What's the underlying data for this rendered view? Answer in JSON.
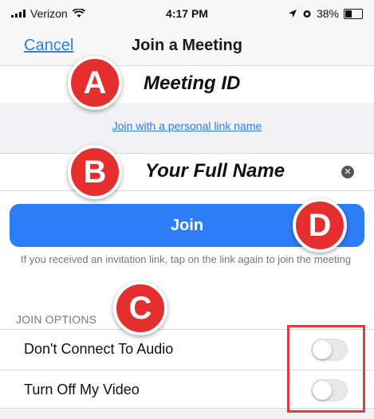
{
  "status_bar": {
    "carrier": "Verizon",
    "time": "4:17 PM",
    "battery": "38%"
  },
  "nav": {
    "cancel_label": "Cancel",
    "title": "Join a Meeting"
  },
  "meeting_id_field": {
    "text": "Meeting ID"
  },
  "personal_link": {
    "label": "Join with a personal link name"
  },
  "name_field": {
    "text": "Your Full Name",
    "clear_icon": "x-circle-icon"
  },
  "join_button": {
    "label": "Join"
  },
  "info_text": "If you received an invitation link, tap on the link again to join the meeting",
  "join_options": {
    "header": "JOIN OPTIONS",
    "items": [
      {
        "label": "Don't Connect To Audio",
        "enabled": false
      },
      {
        "label": "Turn Off My Video",
        "enabled": false
      }
    ]
  },
  "annotations": {
    "badges": [
      "A",
      "B",
      "C",
      "D"
    ],
    "badge_color": "#e52f2f",
    "highlight_color": "#e23c3c"
  },
  "colors": {
    "accent": "#2d7df6",
    "toggle_off": "#e9e9ea"
  }
}
